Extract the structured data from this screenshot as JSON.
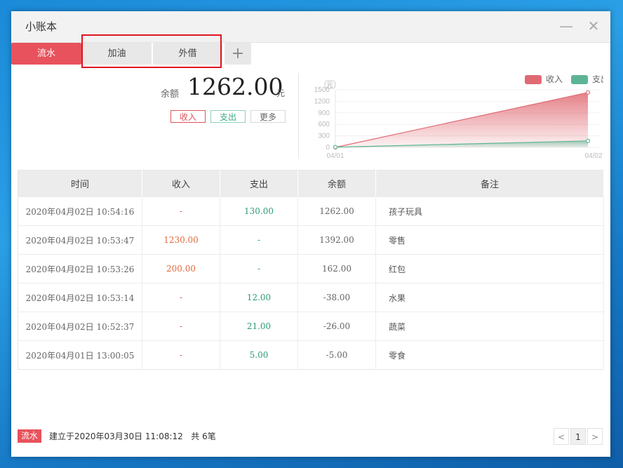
{
  "window": {
    "title": "小账本"
  },
  "tabs": [
    {
      "label": "流水",
      "active": true
    },
    {
      "label": "加油",
      "active": false
    },
    {
      "label": "外借",
      "active": false
    }
  ],
  "summary": {
    "balance_label": "余额",
    "balance_value": "1262.00",
    "unit": "元",
    "buttons": {
      "income": "收入",
      "expense": "支出",
      "more": "更多"
    }
  },
  "chart_data": {
    "type": "area",
    "unit": "元",
    "x": [
      "04/01",
      "04/02"
    ],
    "ylim": [
      0,
      1500
    ],
    "yticks": [
      0,
      300,
      600,
      900,
      1200,
      1500
    ],
    "legend": "top-right",
    "series": [
      {
        "name": "收入",
        "values": [
          0,
          1430
        ],
        "color": "#e06a73"
      },
      {
        "name": "支出",
        "values": [
          5,
          168
        ],
        "color": "#5db494"
      }
    ]
  },
  "table": {
    "headers": [
      "时间",
      "收入",
      "支出",
      "余额",
      "备注"
    ],
    "rows": [
      {
        "time": "2020年04月02日 10:54:16",
        "income": "-",
        "expense": "130.00",
        "balance": "1262.00",
        "note": "孩子玩具"
      },
      {
        "time": "2020年04月02日 10:53:47",
        "income": "1230.00",
        "expense": "-",
        "balance": "1392.00",
        "note": "零售"
      },
      {
        "time": "2020年04月02日 10:53:26",
        "income": "200.00",
        "expense": "-",
        "balance": "162.00",
        "note": "红包"
      },
      {
        "time": "2020年04月02日 10:53:14",
        "income": "-",
        "expense": "12.00",
        "balance": "-38.00",
        "note": "水果"
      },
      {
        "time": "2020年04月02日 10:52:37",
        "income": "-",
        "expense": "21.00",
        "balance": "-26.00",
        "note": "蔬菜"
      },
      {
        "time": "2020年04月01日 13:00:05",
        "income": "-",
        "expense": "5.00",
        "balance": "-5.00",
        "note": "零食"
      }
    ]
  },
  "footer": {
    "badge": "流水",
    "created": "建立于2020年03月30日 11:08:12",
    "count": "共 6笔",
    "page": "1",
    "prev": "<",
    "next": ">"
  },
  "colors": {
    "accent": "#e8525c",
    "income": "#e06a73",
    "expense": "#5db494"
  }
}
